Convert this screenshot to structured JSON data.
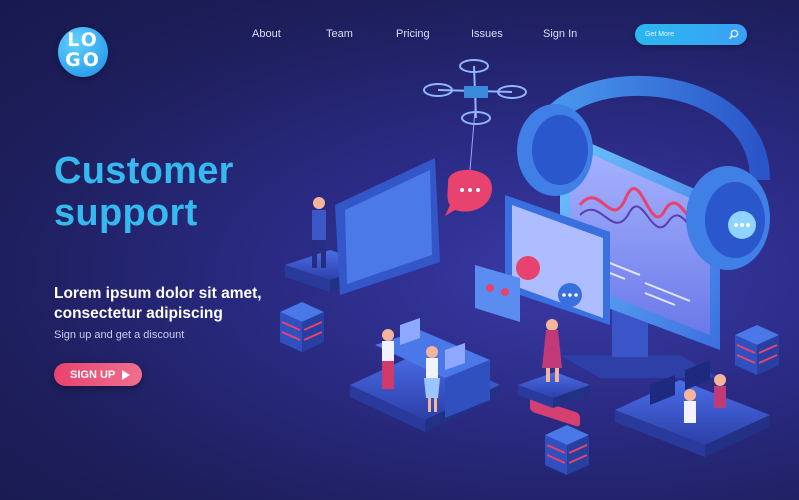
{
  "brand": {
    "logo_text": "LO\nGO"
  },
  "nav": {
    "items": [
      {
        "label": "About"
      },
      {
        "label": "Team"
      },
      {
        "label": "Pricing"
      },
      {
        "label": "Issues"
      },
      {
        "label": "Sign In"
      }
    ]
  },
  "search": {
    "placeholder": "Get More",
    "icon": "search-icon"
  },
  "hero": {
    "title_line1": "Customer",
    "title_line2": "support",
    "subtitle_line1": "Lorem ipsum dolor sit amet,",
    "subtitle_line2": "consectetur adipiscing",
    "note": "Sign up and get a discount",
    "cta_label": "SIGN UP"
  },
  "colors": {
    "accent": "#35b9ee",
    "cta": "#e8426e",
    "background": "#23246e"
  }
}
